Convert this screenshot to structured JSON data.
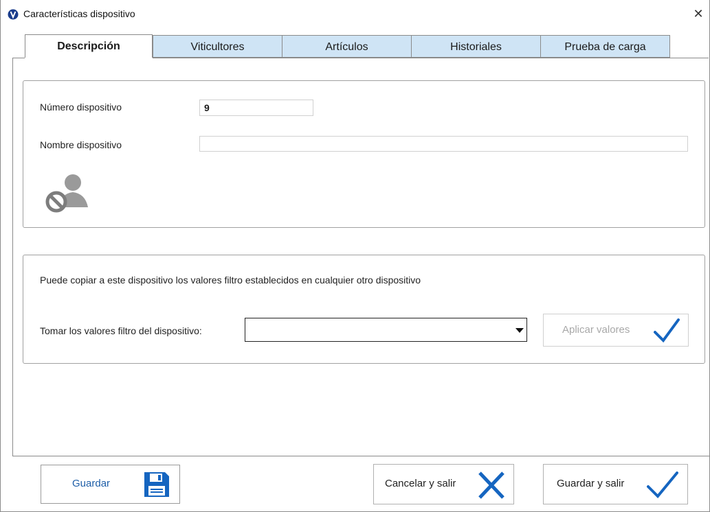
{
  "window": {
    "title": "Características dispositivo",
    "close_glyph": "✕",
    "icon": "app-logo-v"
  },
  "tabs": [
    {
      "label": "Descripción",
      "active": true
    },
    {
      "label": "Viticultores",
      "active": false
    },
    {
      "label": "Artículos",
      "active": false
    },
    {
      "label": "Historiales",
      "active": false
    },
    {
      "label": "Prueba de carga",
      "active": false
    }
  ],
  "device": {
    "number_label": "Número dispositivo",
    "number_value": "9",
    "name_label": "Nombre dispositivo",
    "name_value": "",
    "status_icon": "user-blocked-icon"
  },
  "copy_filters": {
    "info_text": "Puede copiar a este dispositivo los valores filtro establecidos en cualquier otro dispositivo",
    "select_label": "Tomar los valores filtro del dispositivo:",
    "select_value": "",
    "apply_label": "Aplicar valores"
  },
  "footer": {
    "save_label": "Guardar",
    "cancel_label": "Cancelar y salir",
    "save_exit_label": "Guardar y salir"
  },
  "colors": {
    "tab_inactive": "#cfe4f5",
    "accent_blue": "#1565c0",
    "save_label_blue": "#1f5fa8"
  }
}
